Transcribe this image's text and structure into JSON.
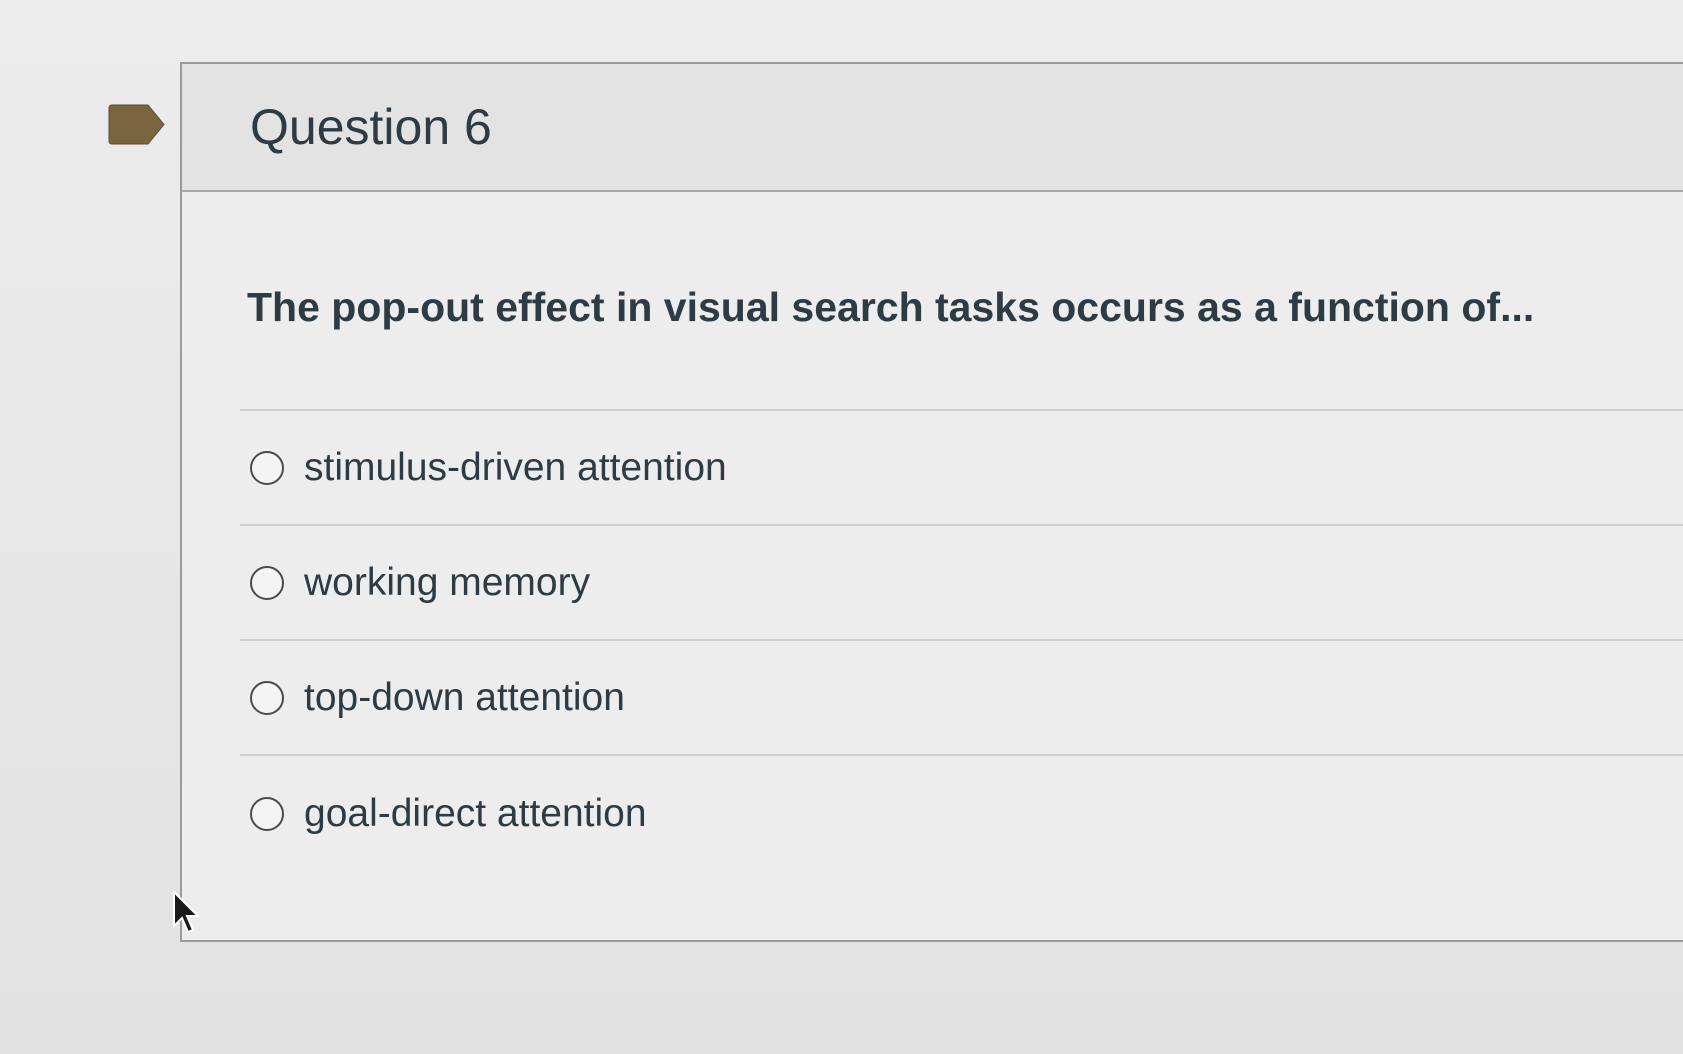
{
  "question": {
    "title": "Question 6",
    "text": "The pop-out effect in visual search tasks occurs as a function of...",
    "answers": [
      {
        "label": "stimulus-driven attention",
        "selected": false
      },
      {
        "label": "working memory",
        "selected": false
      },
      {
        "label": "top-down attention",
        "selected": false
      },
      {
        "label": "goal-direct attention",
        "selected": false
      }
    ]
  },
  "flag": {
    "icon": "bookmark-flag-icon",
    "color": "#7a6541"
  },
  "cursor": {
    "icon": "mouse-pointer-icon"
  },
  "colors": {
    "text": "#2d3b45",
    "border": "#9a9a9a",
    "header_bg": "#e3e3e3"
  }
}
